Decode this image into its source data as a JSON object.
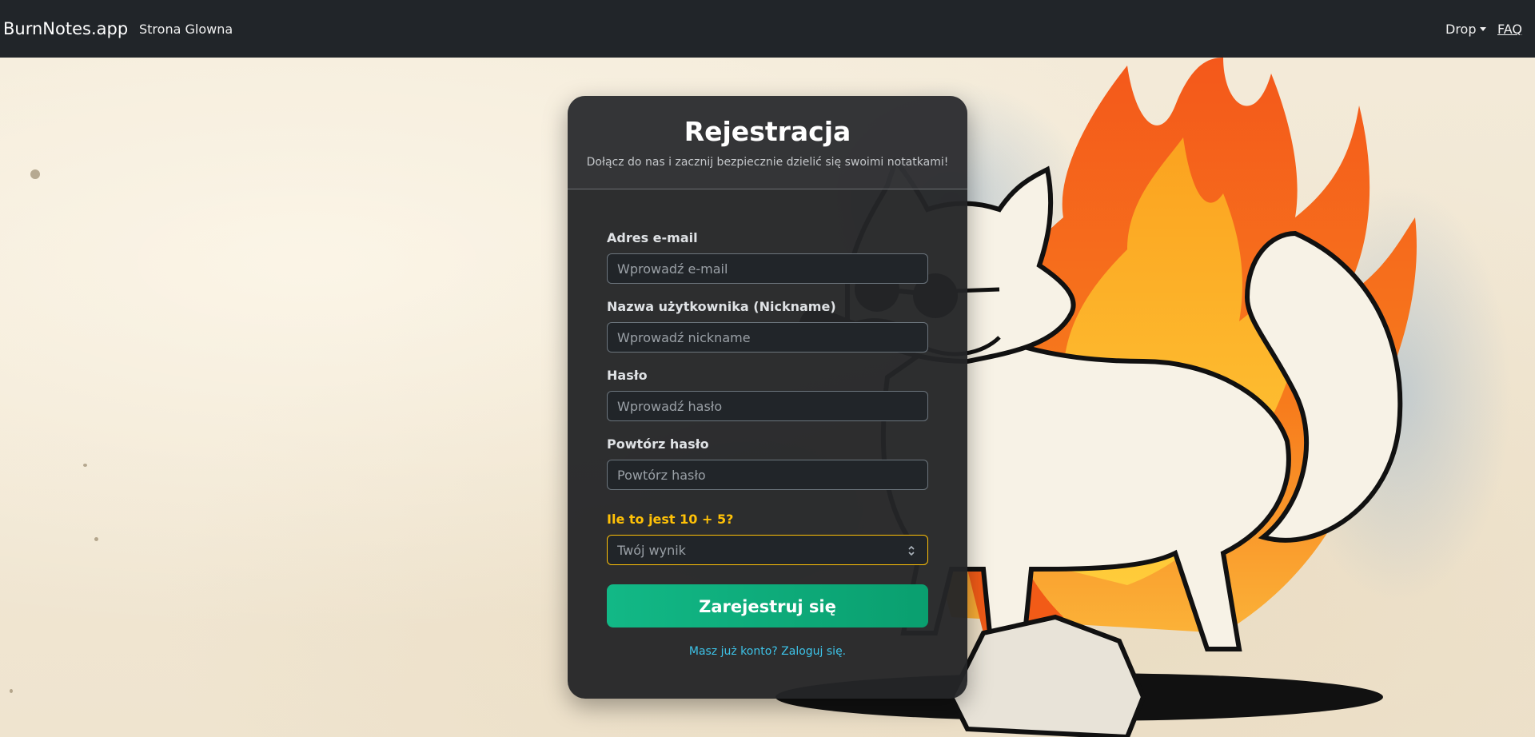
{
  "navbar": {
    "brand": "BurnNotes.app",
    "home_link": "Strona Glowna",
    "drop_label": "Drop",
    "faq_link": "FAQ"
  },
  "card": {
    "title": "Rejestracja",
    "subtitle": "Dołącz do nas i zacznij bezpiecznie dzielić się swoimi notatkami!",
    "fields": [
      {
        "label": "Adres e-mail",
        "placeholder": "Wprowadź e-mail"
      },
      {
        "label": "Nazwa użytkownika (Nickname)",
        "placeholder": "Wprowadź nickname"
      },
      {
        "label": "Hasło",
        "placeholder": "Wprowadź hasło"
      },
      {
        "label": "Powtórz hasło",
        "placeholder": "Powtórz hasło"
      }
    ],
    "captcha": {
      "label": "Ile to jest 10 + 5?",
      "placeholder": "Twój wynik"
    },
    "submit_label": "Zarejestruj się",
    "login_link": "Masz już konto? Zaloguj się."
  },
  "colors": {
    "navbar_bg": "#212529",
    "accent_green": "#12b886",
    "captcha_gold": "#ffc107",
    "link_cyan": "#3dc3e8"
  },
  "illustration": {
    "icon": "fox-mascot-on-fire"
  }
}
